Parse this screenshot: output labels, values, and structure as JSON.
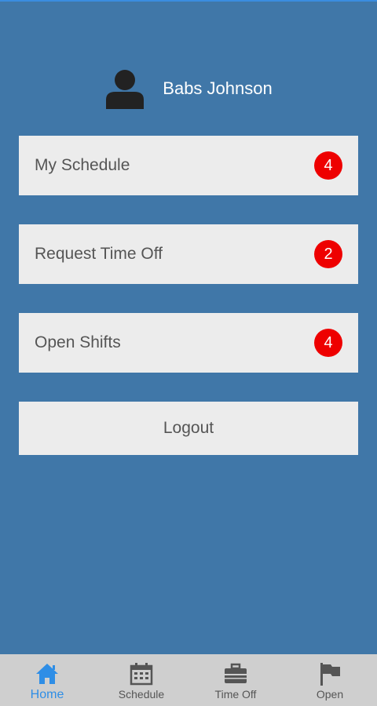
{
  "user": {
    "name": "Babs Johnson"
  },
  "menu": [
    {
      "label": "My Schedule",
      "badge": "4"
    },
    {
      "label": "Request Time Off",
      "badge": "2"
    },
    {
      "label": "Open Shifts",
      "badge": "4"
    }
  ],
  "logout_label": "Logout",
  "nav": [
    {
      "label": "Home",
      "icon": "home-icon",
      "active": true
    },
    {
      "label": "Schedule",
      "icon": "calendar-icon",
      "active": false
    },
    {
      "label": "Time Off",
      "icon": "briefcase-icon",
      "active": false
    },
    {
      "label": "Open",
      "icon": "flag-icon",
      "active": false
    }
  ],
  "colors": {
    "background": "#4077a8",
    "badge": "#ee0000",
    "active_nav": "#2f8ee6",
    "nav_bar": "#cfcfcf"
  }
}
